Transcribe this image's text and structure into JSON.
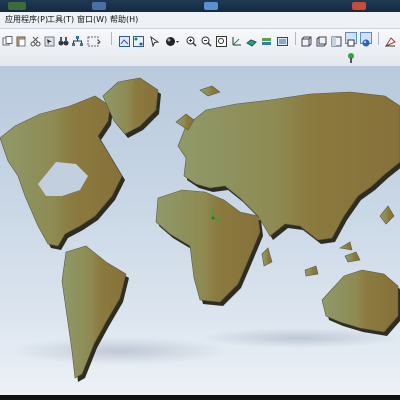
{
  "menubar": {
    "items": [
      {
        "label": "应用程序(P)"
      },
      {
        "label": "工具(T)"
      },
      {
        "label": "窗口(W)"
      },
      {
        "label": "帮助(H)"
      }
    ]
  },
  "toolbar": {
    "icons": [
      "copy-icon",
      "paste-icon",
      "cut-icon",
      "select-icon",
      "binoculars-icon",
      "grid-icon",
      "frame-icon",
      "pick-icon",
      "sphere-icon",
      "zoom-in-icon",
      "zoom-out-icon",
      "zoom-extent-icon",
      "axis-icon",
      "surface-icon",
      "layers-icon",
      "render-icon",
      "cube-front-icon",
      "cube-back-icon",
      "cube-side-icon",
      "view-select-icon",
      "shade-icon",
      "draw-icon"
    ],
    "status_icon": "pin-icon"
  },
  "viewport": {
    "land_color": "#8b7a3e",
    "land_color_west": "#8e9564",
    "shadow_color": "#2a2a25"
  }
}
